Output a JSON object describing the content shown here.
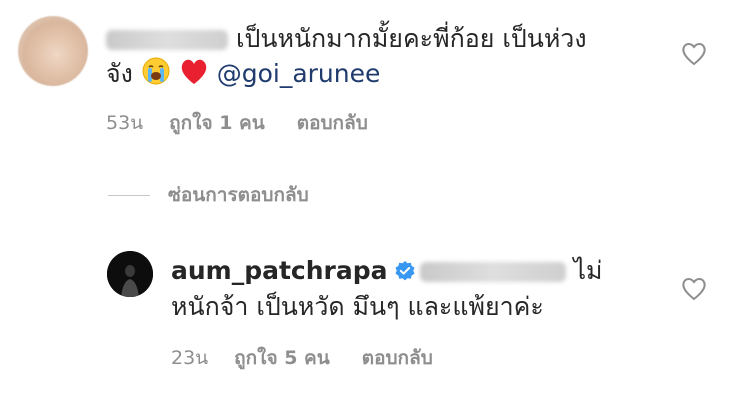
{
  "comment1": {
    "username_blurred": "may_aum",
    "text_line1": "เป็นหนักมากมั้ยคะพี่ก้อย เป็นห่วง",
    "text_line2_prefix": "จัง",
    "mention": "@goi_arunee",
    "time": "53น",
    "likes": "ถูกใจ 1 คน",
    "reply": "ตอบกลับ"
  },
  "hide_replies": "ซ่อนการตอบกลับ",
  "comment2": {
    "username": "aum_patchrapa",
    "mention_blurred": "@may_aum",
    "text_line1_suffix": "ไม่",
    "text_line2": "หนักจ้า เป็นหวัด มึนๆ และแพ้ยาค่ะ",
    "time": "23น",
    "likes": "ถูกใจ 5 คน",
    "reply": "ตอบกลับ"
  },
  "icons": {
    "like": "heart-outline-icon",
    "verified": "verified-badge-icon",
    "emoji1": "crying-face-emoji",
    "emoji2": "red-heart-emoji"
  },
  "colors": {
    "mention": "#1f3b6e",
    "meta": "#8e8e8e",
    "verified": "#3897f0",
    "heart_emoji": "#e8202f"
  }
}
